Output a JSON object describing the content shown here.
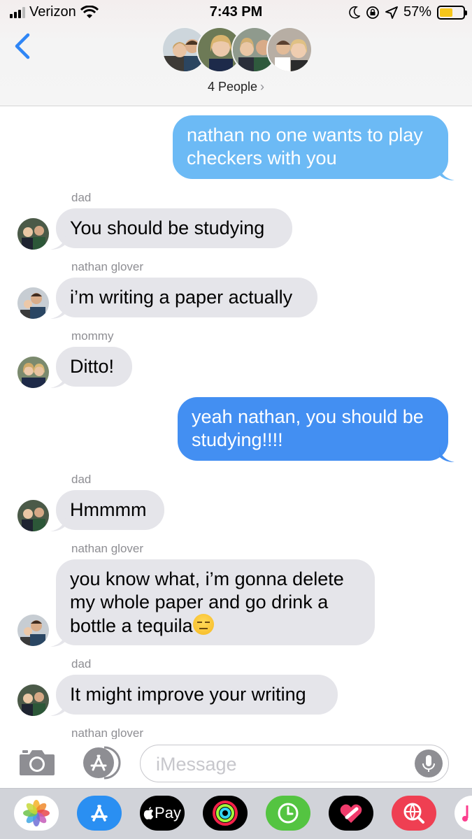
{
  "status_bar": {
    "carrier": "Verizon",
    "time": "7:43 PM",
    "battery": "57%",
    "battery_level": 0.57
  },
  "header": {
    "people_label": "4 People",
    "chevron": "›"
  },
  "messages": [
    {
      "direction": "outgoing",
      "text": "nathan no one wants to play\ncheckers with you"
    },
    {
      "direction": "incoming",
      "sender": "dad",
      "text": "You should be studying"
    },
    {
      "direction": "incoming",
      "sender": "nathan glover",
      "text": "i’m writing a paper actually"
    },
    {
      "direction": "incoming",
      "sender": "mommy",
      "text": "Ditto!"
    },
    {
      "direction": "outgoing",
      "text": "yeah nathan, you should be\nstudying!!!!"
    },
    {
      "direction": "incoming",
      "sender": "dad",
      "text": "Hmmmm"
    },
    {
      "direction": "incoming",
      "sender": "nathan glover",
      "text": "you know what, i’m gonna delete\nmy whole paper and go drink a\nbottle a tequila",
      "emoji": "expressionless-face"
    },
    {
      "direction": "incoming",
      "sender": "dad",
      "text": "It might improve your writing"
    },
    {
      "direction": "incoming",
      "sender": "nathan glover"
    }
  ],
  "composer": {
    "placeholder": "iMessage"
  },
  "app_drawer": {
    "apple_pay_label": "Pay",
    "apps": [
      "photos-app-icon",
      "app-store-icon",
      "apple-pay-icon",
      "activity-icon",
      "clock-app-icon",
      "heart-app-icon",
      "search-globe-app-icon",
      "music-app-icon"
    ]
  },
  "colors": {
    "outgoing_top": "#6ab9f5",
    "outgoing_bottom": "#3b8cf1",
    "incoming": "#e5e5ea",
    "accent": "#2f86f6"
  }
}
